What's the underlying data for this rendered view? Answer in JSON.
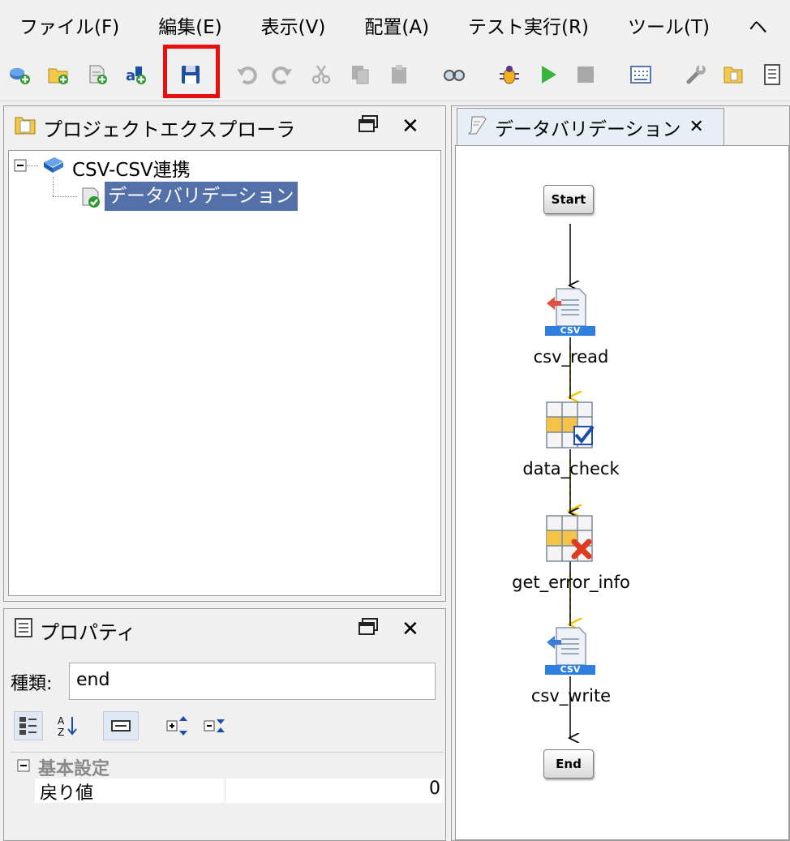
{
  "menu": {
    "items": [
      "ファイル(F)",
      "編集(E)",
      "表示(V)",
      "配置(A)",
      "テスト実行(R)",
      "ツール(T)",
      "ヘ"
    ]
  },
  "toolbar": {
    "buttons": [
      "new-project-icon",
      "new-folder-icon",
      "new-script-icon",
      "new-file-icon",
      "save-icon",
      "undo-icon",
      "redo-icon",
      "cut-icon",
      "copy-icon",
      "paste-icon",
      "find-icon",
      "debug-icon",
      "run-icon",
      "stop-icon",
      "grid-icon",
      "tool-icon",
      "folder-icon",
      "document-icon"
    ]
  },
  "explorer": {
    "title": "プロジェクトエクスプローラ",
    "tree": {
      "root_label": "CSV-CSV連携",
      "child_label": "データバリデーション"
    }
  },
  "properties": {
    "title": "プロパティ",
    "kind_label": "種類:",
    "kind_value": "end",
    "section_label": "基本設定",
    "rows": [
      {
        "name": "戻り値",
        "value": "0"
      }
    ]
  },
  "editor": {
    "tab_title": "データバリデーション",
    "nodes": {
      "start": "Start",
      "csv_read": "csv_read",
      "data_check": "data_check",
      "get_error_info": "get_error_info",
      "csv_write": "csv_write",
      "end": "End",
      "csv_badge": "CSV"
    }
  },
  "colors": {
    "highlight": "#e8100f",
    "selection": "#5470a8",
    "flow_arrow": "#000000",
    "error_flow": "#f5c400"
  }
}
